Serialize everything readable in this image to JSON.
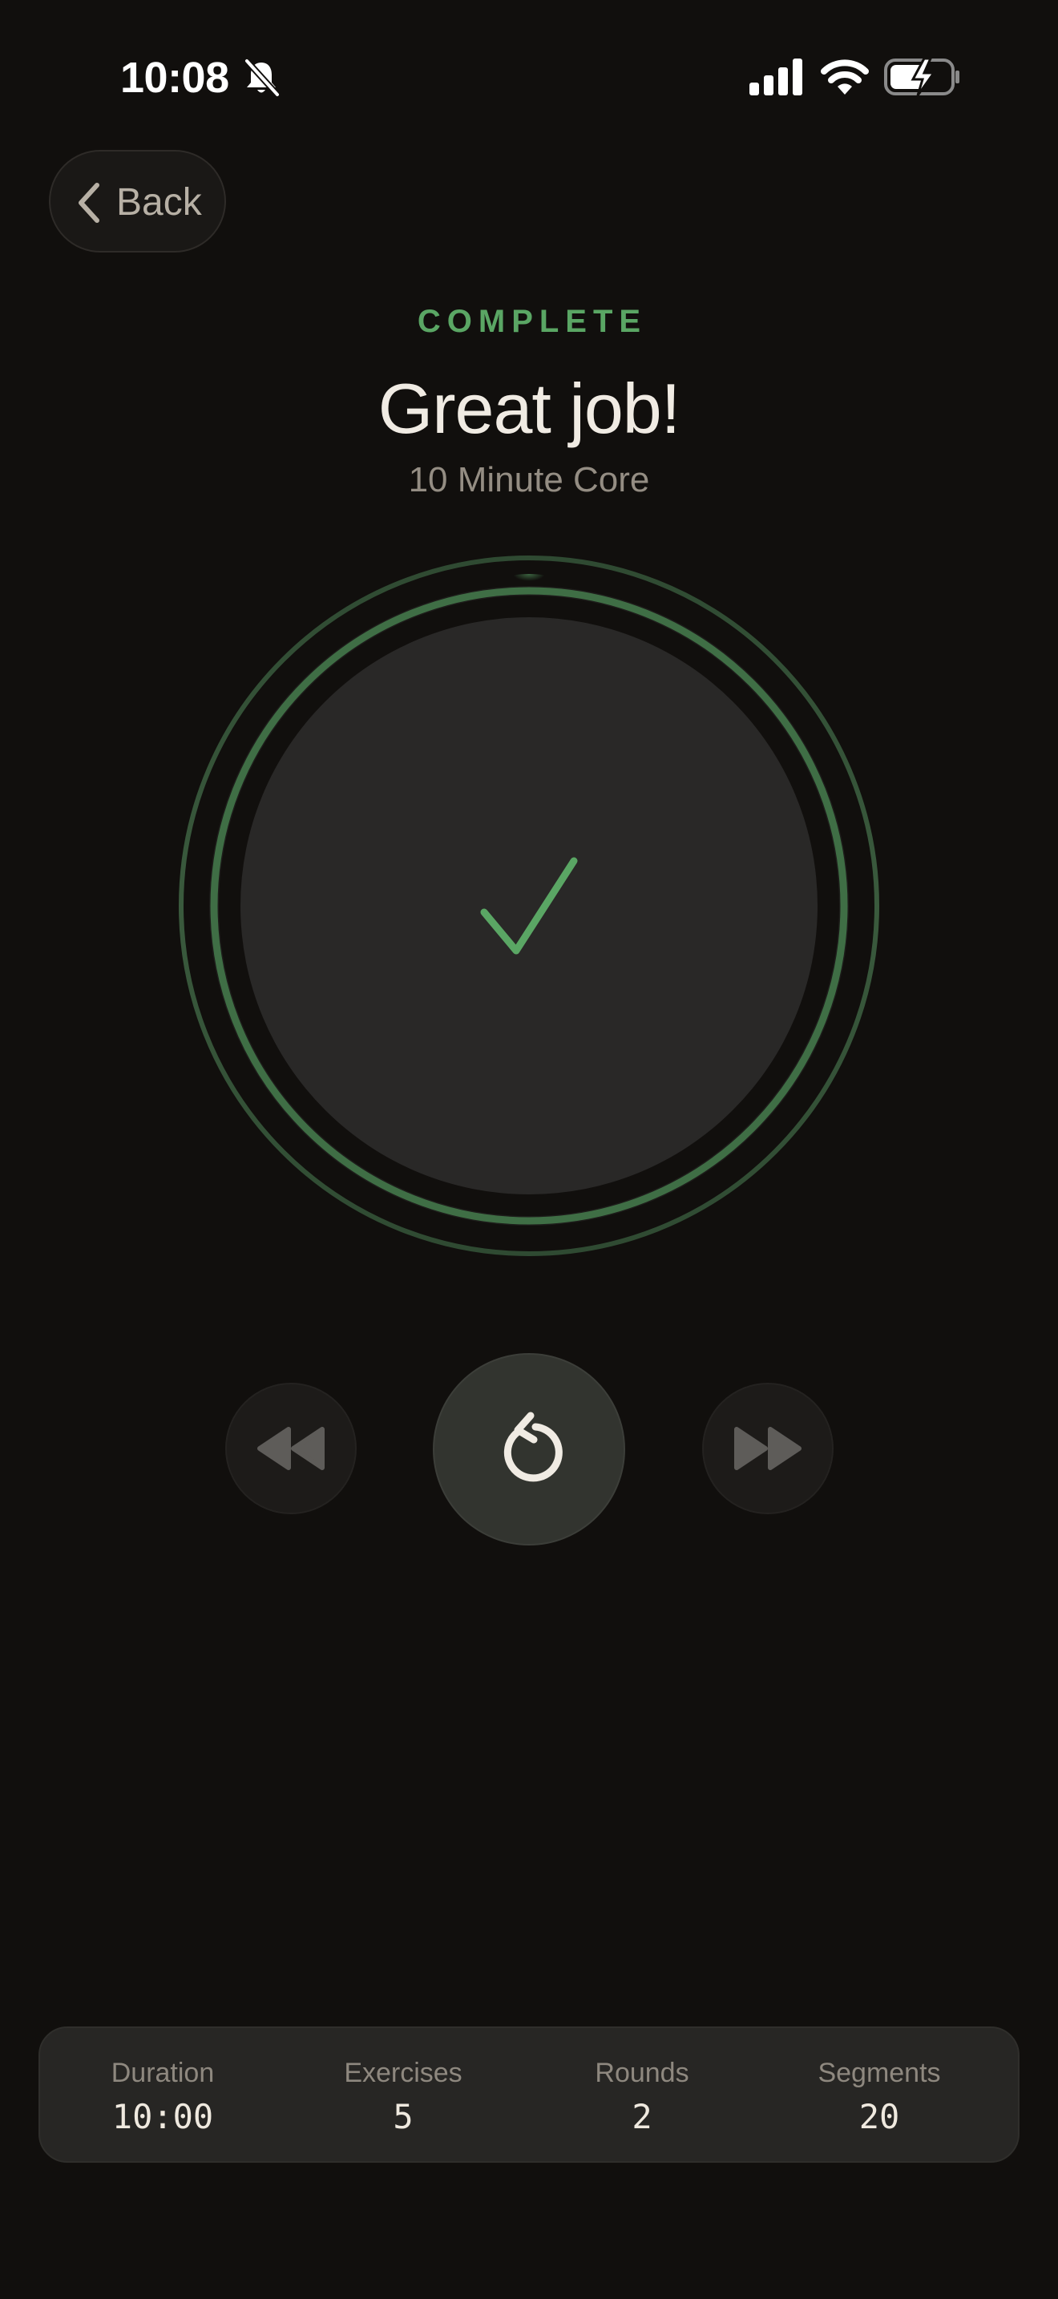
{
  "status_bar": {
    "time": "10:08",
    "icons": [
      "bell-slash-icon",
      "cellular-signal-icon",
      "wifi-icon",
      "battery-charging-icon"
    ]
  },
  "nav": {
    "back_label": "Back",
    "back_icon": "chevron-left-icon"
  },
  "header": {
    "status_label": "COMPLETE",
    "title": "Great job!",
    "workout_name": "10 Minute Core"
  },
  "progress": {
    "fraction_complete": 1.0,
    "center_icon": "checkmark-icon"
  },
  "controls": {
    "rewind_icon": "rewind-icon",
    "restart_icon": "restart-icon",
    "forward_icon": "fast-forward-icon"
  },
  "stats": [
    {
      "label": "Duration",
      "value": "10:00"
    },
    {
      "label": "Exercises",
      "value": "5"
    },
    {
      "label": "Rounds",
      "value": "2"
    },
    {
      "label": "Segments",
      "value": "20"
    }
  ],
  "colors": {
    "background": "#110f0d",
    "accent_green": "#5aa664",
    "ring_green": "#3f6e45",
    "text_primary": "#f0ebe3",
    "text_secondary": "#948d83",
    "card": "#272624"
  }
}
